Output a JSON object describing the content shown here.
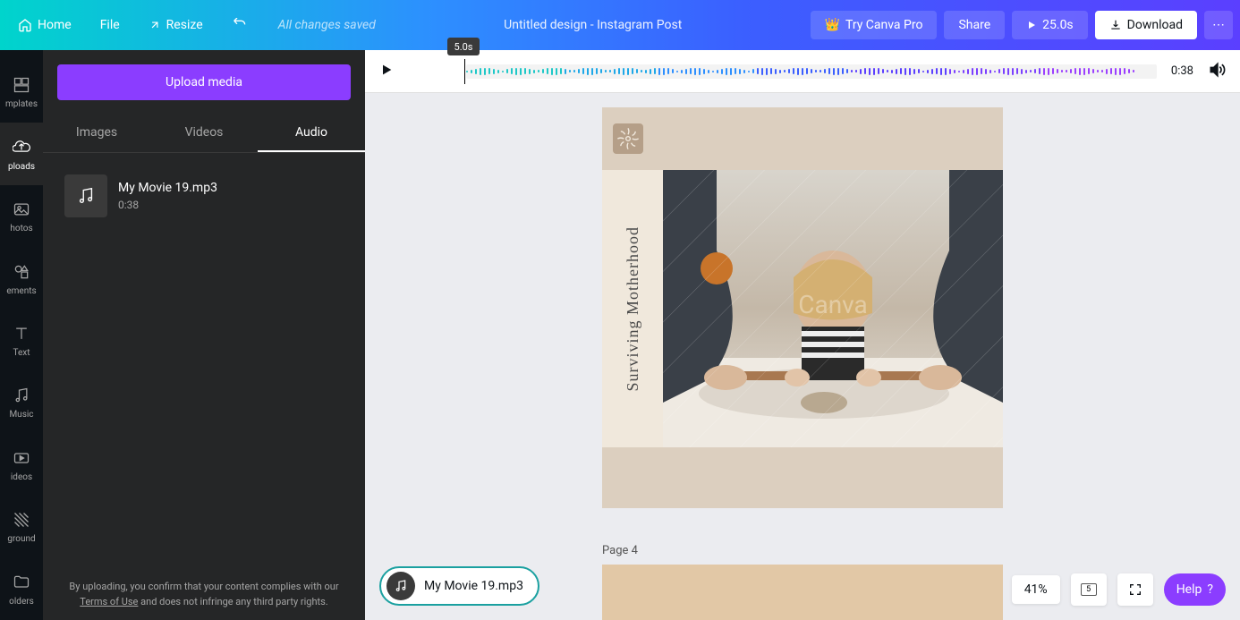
{
  "topbar": {
    "home": "Home",
    "file": "File",
    "resize": "Resize",
    "save_status": "All changes saved",
    "title": "Untitled design - Instagram Post",
    "try_pro": "Try Canva Pro",
    "share": "Share",
    "play_time": "25.0s",
    "download": "Download"
  },
  "rail": {
    "items": [
      {
        "label": "mplates"
      },
      {
        "label": "ploads"
      },
      {
        "label": "hotos"
      },
      {
        "label": "ements"
      },
      {
        "label": "Text"
      },
      {
        "label": "Music"
      },
      {
        "label": "ideos"
      },
      {
        "label": "ground"
      },
      {
        "label": "olders"
      }
    ]
  },
  "panel": {
    "upload_label": "Upload media",
    "tabs": {
      "images": "Images",
      "videos": "Videos",
      "audio": "Audio"
    },
    "audio_items": [
      {
        "name": "My Movie 19.mp3",
        "duration": "0:38"
      }
    ],
    "disclaimer_pre": "By uploading, you confirm that your content complies with our ",
    "disclaimer_link": "Terms of Use",
    "disclaimer_post": " and does not infringe any third party rights."
  },
  "timeline": {
    "scrubber": "5.0s",
    "duration": "0:38"
  },
  "canvas": {
    "side_text": "Surviving Motherhood",
    "page4_label": "Page 4"
  },
  "audio_pill": {
    "label": "My Movie 19.mp3"
  },
  "bottom": {
    "zoom": "41%",
    "page_count": "5",
    "help": "Help",
    "help_mark": "?"
  }
}
